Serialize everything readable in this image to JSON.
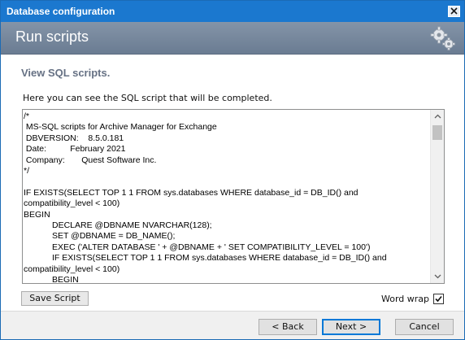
{
  "window": {
    "title": "Database configuration",
    "close_icon": "close-icon"
  },
  "banner": {
    "heading": "Run scripts",
    "icon": "gears-icon"
  },
  "content": {
    "subtitle": "View SQL scripts.",
    "description": "Here you can see the SQL script that will be completed.",
    "script_text": "/*\n MS-SQL scripts for Archive Manager for Exchange\n DBVERSION:    8.5.0.181\n Date:          February 2021\n Company:       Quest Software Inc.\n*/\n\nIF EXISTS(SELECT TOP 1 1 FROM sys.databases WHERE database_id = DB_ID() and compatibility_level < 100)\nBEGIN\n            DECLARE @DBNAME NVARCHAR(128);\n            SET @DBNAME = DB_NAME();\n            EXEC ('ALTER DATABASE ' + @DBNAME + ' SET COMPATIBILITY_LEVEL = 100')\n            IF EXISTS(SELECT TOP 1 1 FROM sys.databases WHERE database_id = DB_ID() and compatibility_level < 100)\n            BEGIN\n                        RAISERROR (N'The current database %s does not support required compatibility level (at"
  },
  "actions": {
    "save_script_label": "Save Script",
    "word_wrap_label": "Word wrap",
    "word_wrap_checked": true
  },
  "footer": {
    "back_label": "< Back",
    "next_label": "Next >",
    "cancel_label": "Cancel"
  },
  "colors": {
    "titlebar": "#1b78cf",
    "banner": "#7788a0",
    "subtitle": "#667184",
    "accent_border": "#0078d7"
  }
}
